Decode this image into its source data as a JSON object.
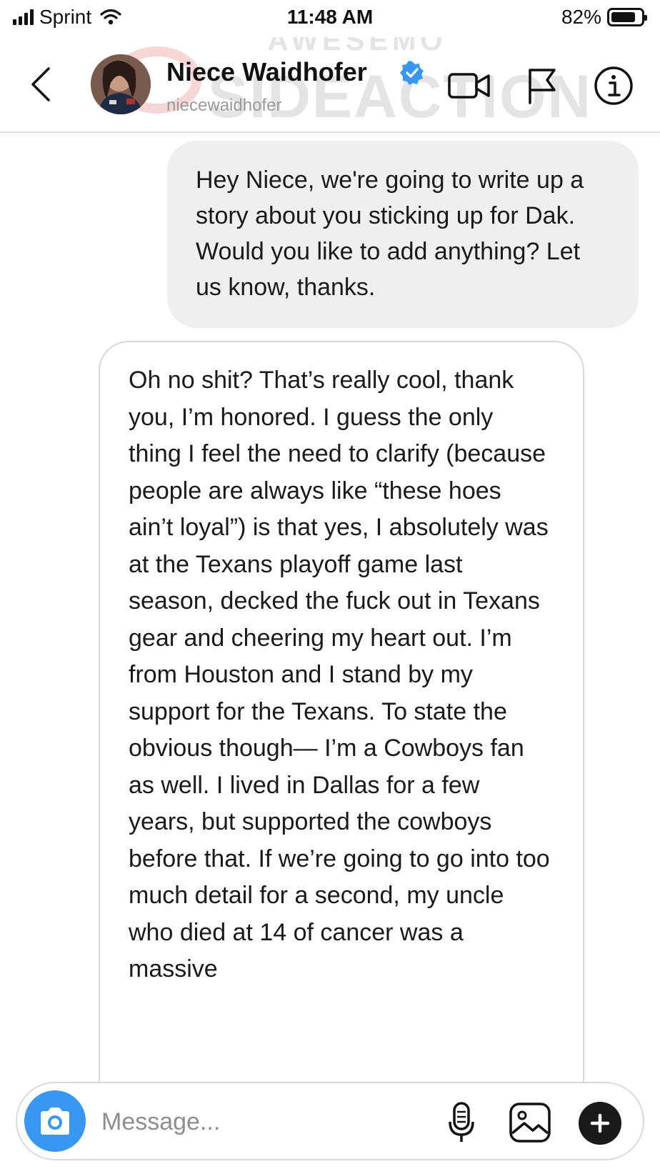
{
  "status_bar": {
    "carrier": "Sprint",
    "time": "11:48 AM",
    "battery_percent": "82%",
    "battery_level": 0.82,
    "signal_bars": 4
  },
  "header": {
    "name": "Niece Waidhofer",
    "handle": "niecewaidhofer",
    "verified": true,
    "watermark_top": "AWESEMO",
    "watermark_bottom": "SIDEACTION",
    "icons": [
      "back-arrow-icon",
      "video-call-icon",
      "flag-icon",
      "info-icon"
    ]
  },
  "messages": [
    {
      "direction": "sent",
      "text": "Hey Niece, we're going to write up a story about you sticking up for Dak. Would you like to add anything?  Let us know, thanks."
    },
    {
      "direction": "received",
      "text": "Oh no shit? That’s really cool, thank you, I’m honored. I guess the only thing I feel the need to clarify (because people are always like “these hoes ain’t loyal”) is that yes, I absolutely was at the Texans playoff game last season, decked the fuck out in Texans gear and cheering my heart out. I’m from Houston and I stand by my support for the Texans. To state the obvious though— I’m a Cowboys fan as well. I lived in Dallas for a few years, but supported the cowboys before that. If we’re going to go into too much detail for a second, my uncle who died at 14 of cancer was a massive"
    }
  ],
  "composer": {
    "placeholder": "Message...",
    "value": "",
    "icons": [
      "camera-icon",
      "microphone-icon",
      "gallery-icon",
      "plus-icon"
    ]
  },
  "colors": {
    "accent": "#3897f0",
    "sent_bubble": "#efefef",
    "verified_badge": "#3897f0",
    "watermark": "#e0e0e0"
  }
}
